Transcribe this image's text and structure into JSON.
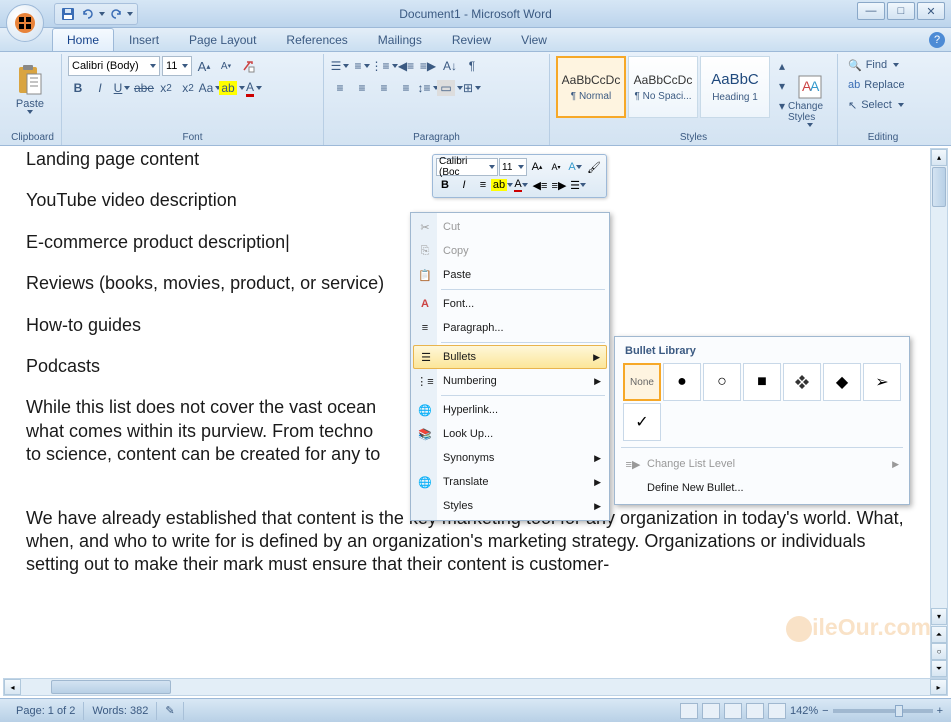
{
  "window": {
    "title": "Document1 - Microsoft Word"
  },
  "tabs": [
    "Home",
    "Insert",
    "Page Layout",
    "References",
    "Mailings",
    "Review",
    "View"
  ],
  "active_tab": 0,
  "ribbon": {
    "clipboard": {
      "paste": "Paste",
      "label": "Clipboard"
    },
    "font": {
      "family": "Calibri (Body)",
      "size": "11",
      "label": "Font"
    },
    "paragraph": {
      "label": "Paragraph"
    },
    "styles": {
      "label": "Styles",
      "items": [
        {
          "preview": "AaBbCcDc",
          "name": "¶ Normal",
          "selected": true
        },
        {
          "preview": "AaBbCcDc",
          "name": "¶ No Spaci...",
          "selected": false
        },
        {
          "preview": "AaBbC",
          "name": "Heading 1",
          "selected": false
        }
      ],
      "change": "Change Styles"
    },
    "editing": {
      "label": "Editing",
      "find": "Find",
      "replace": "Replace",
      "select": "Select"
    }
  },
  "document": {
    "lines": [
      "Landing page content",
      "YouTube video description",
      "E-commerce product description",
      "Reviews (books, movies, product, or service)",
      "How-to guides",
      "Podcasts"
    ],
    "para1": "While this list does not cover the vast ocean",
    "para1b": "what comes within its purview. From techno",
    "para1c": "to science, content can be created for any to",
    "para2": "We have already established that content is the key marketing tool for any organization in today's world. What, when, and who to write for is defined by an organization's marketing strategy. Organizations or individuals setting out to make their mark must ensure that their content is customer-"
  },
  "mini_toolbar": {
    "font": "Calibri (Boc",
    "size": "11"
  },
  "ctx_menu": [
    {
      "icon": "cut",
      "label": "Cut",
      "disabled": true
    },
    {
      "icon": "copy",
      "label": "Copy",
      "disabled": true
    },
    {
      "icon": "paste",
      "label": "Paste"
    },
    {
      "icon": "font",
      "label": "Font..."
    },
    {
      "icon": "para",
      "label": "Paragraph..."
    },
    {
      "icon": "bullets",
      "label": "Bullets",
      "arrow": true,
      "hl": true
    },
    {
      "icon": "numbering",
      "label": "Numbering",
      "arrow": true
    },
    {
      "icon": "link",
      "label": "Hyperlink..."
    },
    {
      "icon": "lookup",
      "label": "Look Up..."
    },
    {
      "icon": "syn",
      "label": "Synonyms",
      "arrow": true
    },
    {
      "icon": "trans",
      "label": "Translate",
      "arrow": true
    },
    {
      "icon": "styles",
      "label": "Styles",
      "arrow": true
    }
  ],
  "bullet_lib": {
    "header": "Bullet Library",
    "cells": [
      "None",
      "●",
      "○",
      "■",
      "❖",
      "◆",
      "➢",
      "✓"
    ],
    "change_level": "Change List Level",
    "define": "Define New Bullet..."
  },
  "status": {
    "page": "Page: 1 of 2",
    "words": "Words: 382",
    "zoom": "142%"
  },
  "watermark": "ileOur.com"
}
